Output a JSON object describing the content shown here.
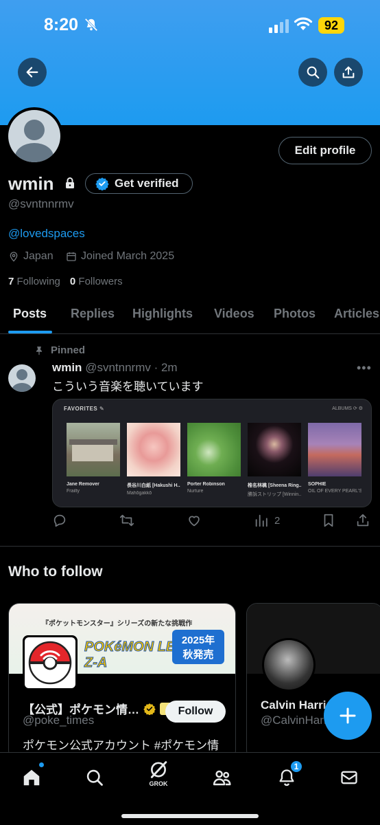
{
  "status_bar": {
    "time": "8:20",
    "battery": "92"
  },
  "profile": {
    "name": "wmin",
    "handle": "@svntnnrmv",
    "edit_label": "Edit profile",
    "verify_label": "Get verified",
    "bio_link": "@lovedspaces",
    "location": "Japan",
    "joined": "Joined March 2025",
    "following_count": "7",
    "following_label": "Following",
    "followers_count": "0",
    "followers_label": "Followers"
  },
  "tabs": [
    "Posts",
    "Replies",
    "Highlights",
    "Videos",
    "Photos",
    "Articles"
  ],
  "post": {
    "pinned_label": "Pinned",
    "author": "wmin",
    "meta": "@svntnnrmv · 2m",
    "text": "こういう音楽を聴いています",
    "card": {
      "title": "FAVORITES",
      "right": "ALBUMS",
      "albums": [
        {
          "artist": "Jane Remover",
          "title": "Frailty"
        },
        {
          "artist": "長谷川白紙 [Hakushi H...",
          "title": "Mahōgakkō"
        },
        {
          "artist": "Porter Robinson",
          "title": "Nurture"
        },
        {
          "artist": "椎名林檎 [Sheena Ring...",
          "title": "勝訴ストリップ [Winnin..."
        },
        {
          "artist": "SOPHIE",
          "title": "OIL OF EVERY PEARL'S ..."
        }
      ]
    },
    "views": "2"
  },
  "who_to_follow": {
    "title": "Who to follow",
    "cards": [
      {
        "banner_line1": "『ポケットモンスター』シリーズの新たな挑戦作",
        "banner_logo": "POKéMON LEGENDS Z-A",
        "banner_badge1": "2025年",
        "banner_badge2": "秋発売",
        "name": "【公式】ポケモン情…",
        "handle": "@poke_times",
        "desc": "ポケモン公式アカウント #ポケモン情",
        "follow_label": "Follow"
      },
      {
        "name": "Calvin Harris",
        "handle": "@CalvinHarris"
      }
    ]
  },
  "bottom_nav": {
    "grok_label": "GROK",
    "notif_badge": "1"
  },
  "colors": {
    "accent": "#1d9bf0",
    "background": "#000000",
    "muted": "#71767b"
  }
}
